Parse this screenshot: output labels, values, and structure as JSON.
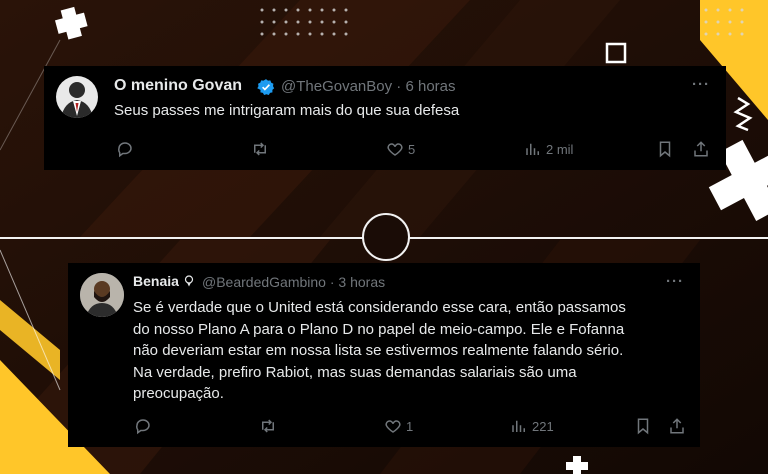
{
  "tweets": [
    {
      "name": "O menino Govan",
      "verified": true,
      "handle": "@TheGovanBoy",
      "time": "6 horas",
      "text": "Seus passes me intrigaram mais do que sua defesa",
      "likes": "5",
      "views": "2 mil",
      "more": "···"
    },
    {
      "name": "Benaia",
      "verified": false,
      "handle": "@BeardedGambino",
      "time": "3 horas",
      "text_lines": [
        "Se é verdade que o United está considerando esse cara, então passamos",
        "do nosso Plano A para o Plano D no papel de meio-campo. Ele e Fofanna",
        "não deveriam estar em nossa lista se estivermos realmente falando sério.",
        "Na verdade, prefiro Rabiot, mas suas demandas salariais são uma",
        "preocupação."
      ],
      "likes": "1",
      "views": "221",
      "more": "···"
    }
  ],
  "separator_dot": "·",
  "colors": {
    "accent": "#ffc629",
    "background": "#1a0c06",
    "panel": "#000000",
    "text": "#e7e9ea",
    "muted": "#71767b",
    "verified": "#1d9bf0"
  }
}
